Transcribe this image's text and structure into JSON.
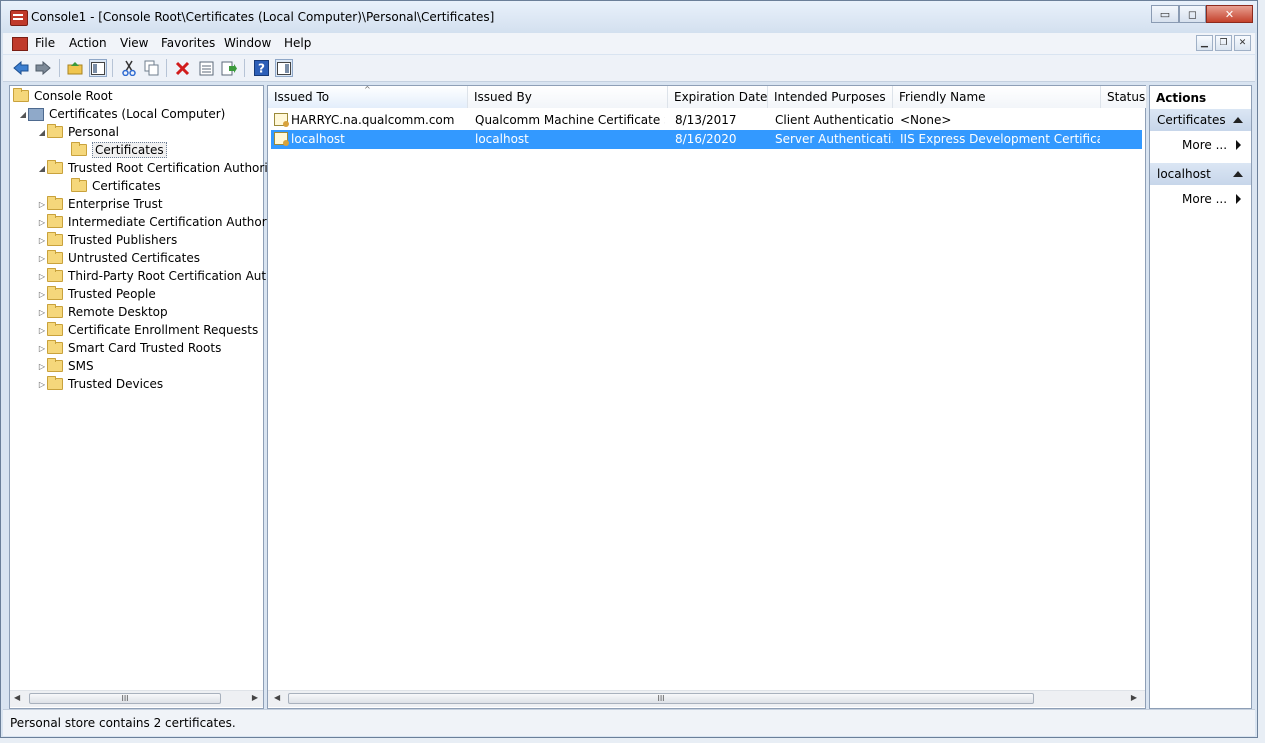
{
  "window": {
    "title": "Console1 - [Console Root\\Certificates (Local Computer)\\Personal\\Certificates]",
    "controls": {
      "minimize": "▭",
      "maximize": "◻",
      "close": "✕"
    }
  },
  "menu": {
    "items": [
      "File",
      "Action",
      "View",
      "Favorites",
      "Window",
      "Help"
    ],
    "mdi": {
      "minimize": "▁",
      "restore": "❐",
      "close": "✕"
    }
  },
  "toolbar": {
    "icons": [
      "back-icon",
      "forward-icon",
      "up-folder-icon",
      "show-hide-tree-icon",
      "cut-icon",
      "copy-icon",
      "delete-icon",
      "properties-icon",
      "export-icon",
      "help-icon",
      "show-hide-action-pane-icon"
    ]
  },
  "tree": {
    "root": "Console Root",
    "computer": "Certificates (Local Computer)",
    "items": [
      {
        "label": "Personal",
        "expanded": true
      },
      {
        "label": "Certificates",
        "selected": true
      },
      {
        "label": "Trusted Root Certification Authorities",
        "expanded": true
      },
      {
        "label": "Certificates"
      },
      {
        "label": "Enterprise Trust"
      },
      {
        "label": "Intermediate Certification Authorities"
      },
      {
        "label": "Trusted Publishers"
      },
      {
        "label": "Untrusted Certificates"
      },
      {
        "label": "Third-Party Root Certification Authorities"
      },
      {
        "label": "Trusted People"
      },
      {
        "label": "Remote Desktop"
      },
      {
        "label": "Certificate Enrollment Requests"
      },
      {
        "label": "Smart Card Trusted Roots"
      },
      {
        "label": "SMS"
      },
      {
        "label": "Trusted Devices"
      }
    ],
    "scroll_label": "III"
  },
  "list": {
    "columns": [
      "Issued To",
      "Issued By",
      "Expiration Date",
      "Intended Purposes",
      "Friendly Name",
      "Status"
    ],
    "rows": [
      {
        "issued_to": "HARRYC.na.qualcomm.com",
        "issued_by": "Qualcomm Machine Certificate S...",
        "expiration": "8/13/2017",
        "purposes": "Client Authentication",
        "friendly": "<None>",
        "status": ""
      },
      {
        "issued_to": "localhost",
        "issued_by": "localhost",
        "expiration": "8/16/2020",
        "purposes": "Server Authenticati...",
        "friendly": "IIS Express Development Certificate",
        "status": "",
        "selected": true
      }
    ],
    "scroll_label": "III"
  },
  "actions": {
    "header": "Actions",
    "sections": [
      {
        "title": "Certificates",
        "items": [
          "More ..."
        ]
      },
      {
        "title": "localhost",
        "items": [
          "More ..."
        ]
      }
    ]
  },
  "status": {
    "text": "Personal store contains 2 certificates."
  }
}
